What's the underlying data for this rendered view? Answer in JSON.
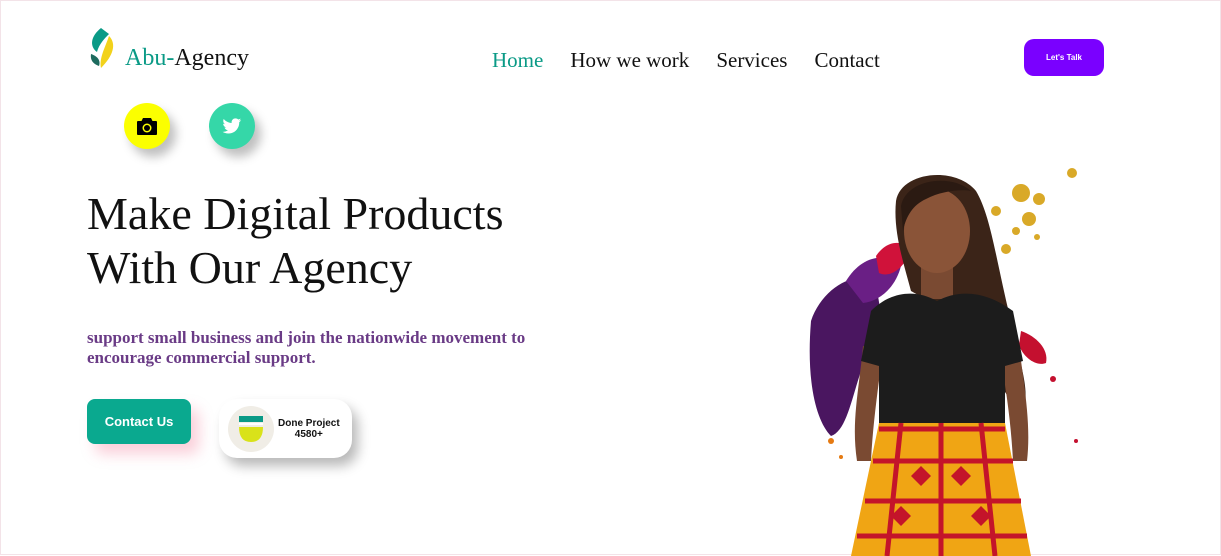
{
  "brand": {
    "prefix": "Abu-",
    "name": "Agency"
  },
  "nav": {
    "items": [
      {
        "label": "Home",
        "active": true
      },
      {
        "label": "How we work",
        "active": false
      },
      {
        "label": "Services",
        "active": false
      },
      {
        "label": "Contact",
        "active": false
      }
    ]
  },
  "header": {
    "cta_label": "Let's Talk"
  },
  "social": [
    {
      "icon": "camera-icon",
      "color": "#fbff00"
    },
    {
      "icon": "twitter-icon",
      "color": "#35d7a8"
    }
  ],
  "hero": {
    "title_line1": "Make Digital Products",
    "title_line2": "With Our Agency",
    "subtitle": "support small business and join the nationwide movement to encourage commercial support.",
    "contact_label": "Contact Us",
    "done_label": "Done Project",
    "done_count": "4580+"
  },
  "colors": {
    "accent": "#0a9a86",
    "cta": "#7a00ff",
    "subtitle": "#6a3b86",
    "contact_button": "#0aa98f"
  }
}
